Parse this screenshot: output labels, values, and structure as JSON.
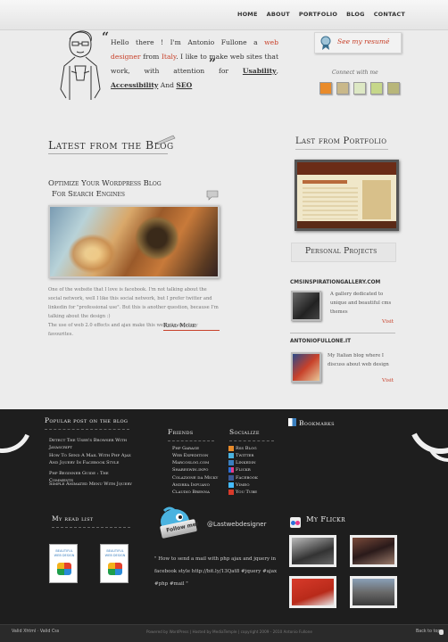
{
  "nav": {
    "items": [
      "HOME",
      "ABOUT",
      "PORTFOLIO",
      "BLOG",
      "CONTACT"
    ]
  },
  "intro": {
    "greeting": "Hello there ! I'm Antonio Fullone a ",
    "role": "web designer",
    "from": " from ",
    "country": "Italy",
    "line2": ". I like to make web sites that work, with attention for ",
    "usability": "Usability",
    "accessibility": "Accessibility",
    "and": " And ",
    "seo": "SEO"
  },
  "resume": {
    "label": "See my resumé"
  },
  "connect": {
    "label": "Connect with me",
    "icons": [
      "rss-icon",
      "linkedin-icon",
      "mail-icon",
      "delicious-icon",
      "user-icon"
    ]
  },
  "blog": {
    "heading": "Latest from the Blog",
    "post_title_1": "Optimize Your Wordpress Blog",
    "post_title_2": "For Search Engines",
    "excerpt_1": "One of the website that I love is facebook. I'm not talking about the social network, well I like this social network, but I prefer twitter and linkedin for \"professional use\". But this is another question, because I'm talking about the design :)",
    "excerpt_2": "The use of web 2.0 effects and ajax make this web site on of my favourites.",
    "read_more": "Read More"
  },
  "portfolio": {
    "heading": "Last from Portfolio"
  },
  "projects": {
    "heading": "Personal Projects",
    "items": [
      {
        "name": "CMSINSPIRATIONGALLERY.COM",
        "desc": "A gallery dedicated to unique and beautiful cms themes",
        "visit": "Visit"
      },
      {
        "name": "ANTONIOFULLONE.IT",
        "desc": "My Italian blog where I discuss about web design",
        "visit": "Visit"
      }
    ]
  },
  "footer": {
    "popular": {
      "heading": "Popular post on the blog",
      "items": [
        "Detect The User's Browser With Javascript",
        "How To Send A Mail With Php Ajax And Jquery In Facebook Style",
        "Php Beginner Guide : The Comments",
        "Simple Animated Menu With Jquery"
      ]
    },
    "friends": {
      "heading": "Friends",
      "items": [
        "Php Garage",
        "Web Expedition",
        "Marcoslog.com",
        "Shareswin.info",
        "Colazione da Micky",
        "Andrea Infuano",
        "Claudio Brenna"
      ]
    },
    "socialize": {
      "heading": "Socialize",
      "items": [
        "Rss Blog",
        "Twitter",
        "Linkedin",
        "Flickr",
        "Facebook",
        "Vimeo",
        "You Tube"
      ]
    },
    "bookmarks": {
      "heading": "Bookmarks"
    },
    "readlist": {
      "heading": "My read list"
    },
    "twitter": {
      "follow": "Follow me!",
      "handle": "@Lastwebdesigner",
      "tweet": "\" How to send a mail with php ajax and jquery in facebook style http://bit.ly/13Qat8 #jquery #ajax #php #mail \""
    },
    "flickr": {
      "heading": "My Flickr"
    }
  },
  "bottom": {
    "left": "Valid Xhtml · Valid Css",
    "mid": "Powered by WordPress | Hosted by MediaTemple | copyright 2009 - 2010 Antonio Fullone",
    "right": "Back to top"
  },
  "colors": {
    "accent": "#c8412a",
    "footer": "#1e1e1e",
    "background": "#ececec"
  }
}
